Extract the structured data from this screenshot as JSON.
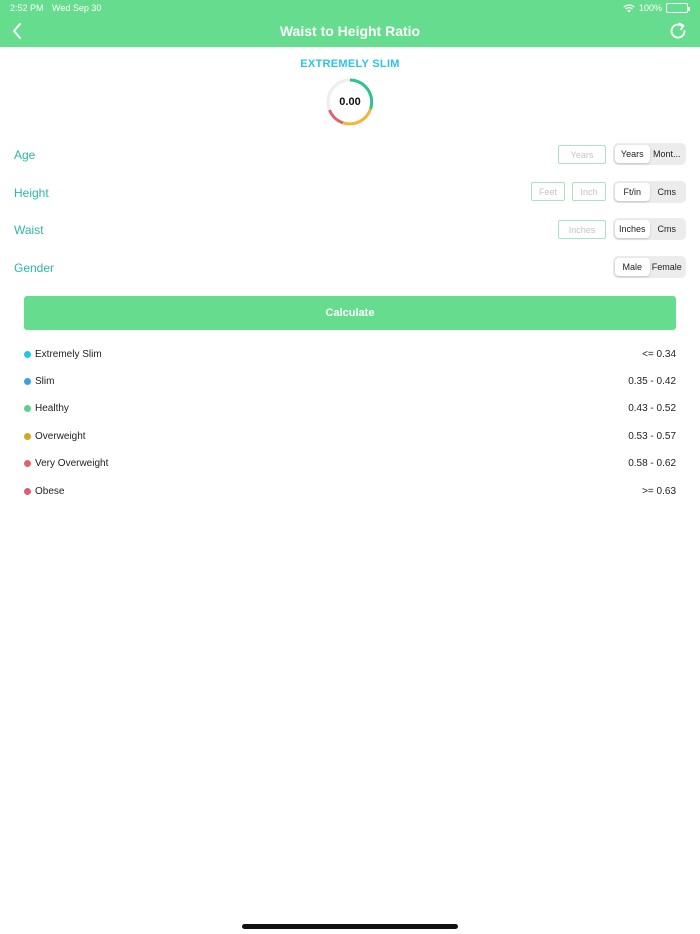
{
  "status_bar": {
    "time": "2:52 PM",
    "date": "Wed Sep 30",
    "battery": "100%"
  },
  "nav": {
    "title": "Waist to Height Ratio"
  },
  "result": {
    "label": "EXTREMELY SLIM",
    "value": "0.00"
  },
  "colors": {
    "accent": "#66dd8e",
    "label_teal": "#2bb8a6",
    "result_cyan": "#2cc6e0"
  },
  "icons": {
    "back": "chevron-left-icon",
    "refresh": "refresh-icon",
    "wifi": "wifi-icon",
    "battery": "battery-icon"
  },
  "form": {
    "age": {
      "label": "Age",
      "placeholder": "Years",
      "units": [
        "Years",
        "Mont..."
      ],
      "selected_unit": "Years"
    },
    "height": {
      "label": "Height",
      "placeholder_feet": "Feet",
      "placeholder_inch": "Inch",
      "units": [
        "Ft/in",
        "Cms"
      ],
      "selected_unit": "Ft/in"
    },
    "waist": {
      "label": "Waist",
      "placeholder": "Inches",
      "units": [
        "Inches",
        "Cms"
      ],
      "selected_unit": "Inches"
    },
    "gender": {
      "label": "Gender",
      "options": [
        "Male",
        "Female"
      ],
      "selected": "Male"
    }
  },
  "calculate_label": "Calculate",
  "legend": [
    {
      "name": "Extremely Slim",
      "range": "<= 0.34",
      "color": "#23c4f0"
    },
    {
      "name": "Slim",
      "range": "0.35 - 0.42",
      "color": "#3f9ee0"
    },
    {
      "name": "Healthy",
      "range": "0.43 - 0.52",
      "color": "#5dcf8a"
    },
    {
      "name": "Overweight",
      "range": "0.53 - 0.57",
      "color": "#d4a41c"
    },
    {
      "name": "Very Overweight",
      "range": "0.58 - 0.62",
      "color": "#e0626a"
    },
    {
      "name": "Obese",
      "range": ">= 0.63",
      "color": "#d9606e"
    }
  ]
}
